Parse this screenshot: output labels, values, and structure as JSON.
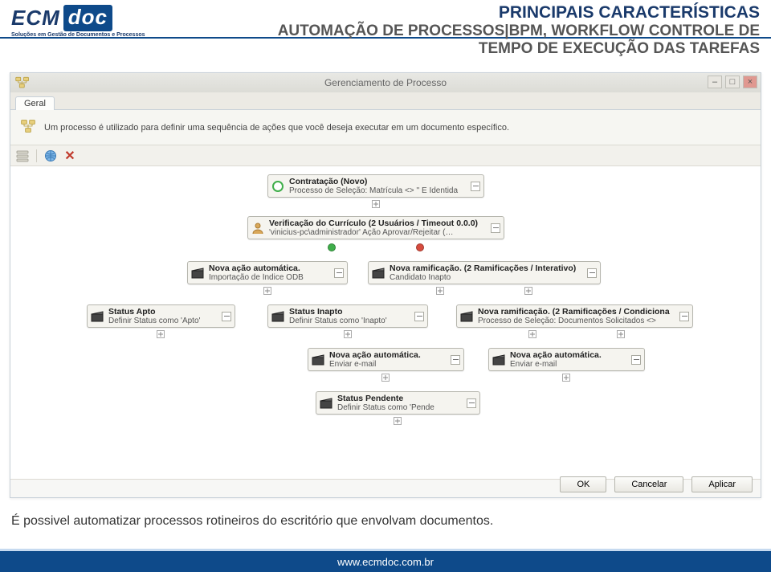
{
  "branding": {
    "logo_left": "ECM",
    "logo_right": "doc",
    "tagline": "Soluções em Gestão de Documentos e Processos"
  },
  "header": {
    "line1": "PRINCIPAIS CARACTERÍSTICAS",
    "line2": "AUTOMAÇÃO DE PROCESSOS|BPM, WORKFLOW CONTROLE DE",
    "line3": "TEMPO DE EXECUÇÃO DAS TAREFAS"
  },
  "window": {
    "title": "Gerenciamento de Processo",
    "tab": "Geral",
    "description": "Um processo é utilizado para definir uma sequência de ações que você deseja executar em um documento específico.",
    "buttons": {
      "ok": "OK",
      "cancel": "Cancelar",
      "apply": "Aplicar"
    }
  },
  "nodes": {
    "contratacao": {
      "title": "Contratação (Novo)",
      "sub": "Processo de Seleção: Matrícula <> '' E Identida"
    },
    "verificacao": {
      "title": "Verificação do Currículo (2 Usuários / Timeout 0.0.0)",
      "sub": "'vinicius-pc\\administrador' Ação Aprovar/Rejeitar (Candid"
    },
    "auto1": {
      "title": "Nova ação automática.",
      "sub": "Importação de Índice ODB"
    },
    "ramif1": {
      "title": "Nova ramificação. (2 Ramificações / Interativo)",
      "sub": "Candidato Inapto"
    },
    "status_apto": {
      "title": "Status Apto",
      "sub": "Definir Status como 'Apto'"
    },
    "status_inapto": {
      "title": "Status Inapto",
      "sub": "Definir Status como 'Inapto'"
    },
    "ramif2": {
      "title": "Nova ramificação. (2 Ramificações / Condiciona",
      "sub": "Processo de Seleção: Documentos Solicitados <>"
    },
    "auto2": {
      "title": "Nova ação automática.",
      "sub": "Enviar e-mail"
    },
    "auto3": {
      "title": "Nova ação automática.",
      "sub": "Enviar e-mail"
    },
    "status_pendente": {
      "title": "Status Pendente",
      "sub": "Definir Status como 'Pende"
    }
  },
  "caption": "É possivel automatizar processos rotineiros do escritório que envolvam documentos.",
  "footer": {
    "url": "www.ecmdoc.com.br"
  },
  "icons": {
    "flow": "flow-icon",
    "globe": "globe-icon",
    "delete": "delete-icon",
    "clapper": "clapper-icon",
    "person": "person-icon",
    "circle": "circle-icon"
  }
}
